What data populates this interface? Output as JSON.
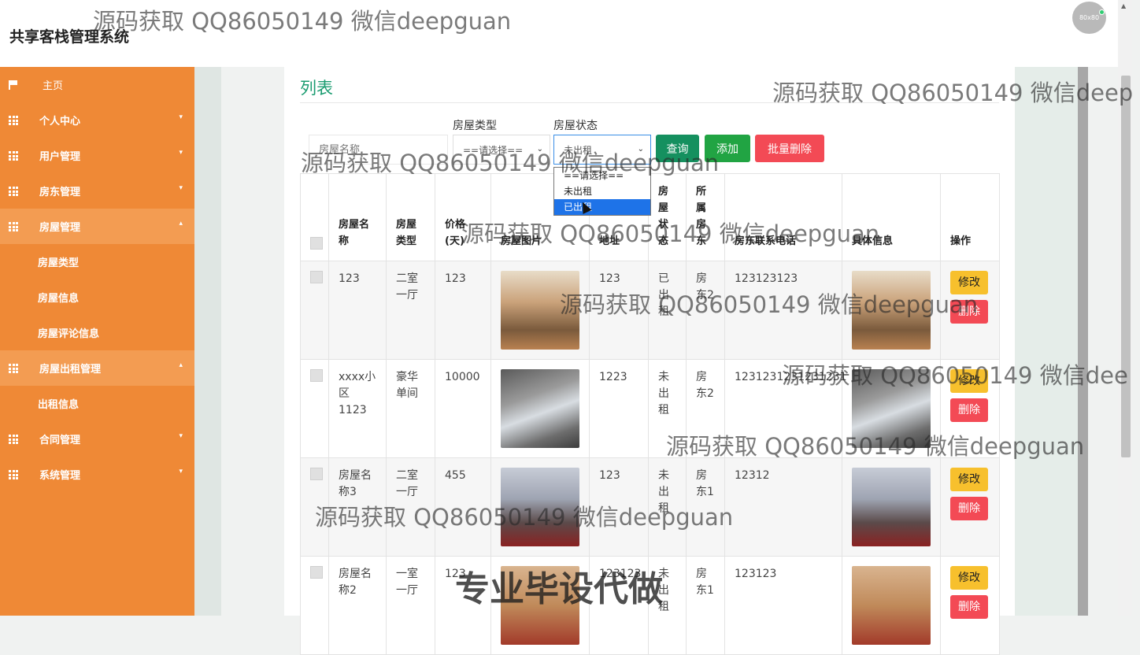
{
  "app": {
    "title": "共享客栈管理系统",
    "avatar_text": "80x80"
  },
  "sidebar": {
    "items": [
      {
        "label": "主页",
        "icon": "flag-icon",
        "caret": ""
      },
      {
        "label": "个人中心",
        "icon": "grid-icon",
        "caret": "▾"
      },
      {
        "label": "用户管理",
        "icon": "grid-icon",
        "caret": "▾"
      },
      {
        "label": "房东管理",
        "icon": "grid-icon",
        "caret": "▾"
      },
      {
        "label": "房屋管理",
        "icon": "grid-icon",
        "caret": "▴"
      },
      {
        "label": "房屋出租管理",
        "icon": "grid-icon",
        "caret": "▴"
      },
      {
        "label": "合同管理",
        "icon": "grid-icon",
        "caret": "▾"
      },
      {
        "label": "系统管理",
        "icon": "grid-icon",
        "caret": "▾"
      }
    ],
    "house_sub": [
      "房屋类型",
      "房屋信息",
      "房屋评论信息"
    ],
    "rent_sub": [
      "出租信息"
    ]
  },
  "main": {
    "title": "列表",
    "search": {
      "name_placeholder": "房屋名称",
      "type_label": "房屋类型",
      "type_value": "==请选择==",
      "status_label": "房屋状态",
      "status_value": "未出租"
    },
    "buttons": {
      "query": "查询",
      "add": "添加",
      "batch_delete": "批量删除"
    },
    "status_dropdown": {
      "options": [
        "==请选择==",
        "未出租",
        "已出租"
      ],
      "highlighted": "已出租"
    },
    "table": {
      "headers": [
        "房屋名称",
        "房屋类型",
        "价格(天)",
        "房屋图片",
        "地址",
        "房屋状态",
        "所属房东",
        "房东联系电话",
        "具体信息",
        "操作"
      ],
      "rows": [
        {
          "name": "123",
          "type": "二室一厅",
          "price": "123",
          "address": "123",
          "status": "已出租",
          "landlord": "房东2",
          "phone": "123123123"
        },
        {
          "name": "xxxx小区1123",
          "type": "豪华单间",
          "price": "10000",
          "address": "1223",
          "status": "未出租",
          "landlord": "房东2",
          "phone": "1231231231231231"
        },
        {
          "name": "房屋名称3",
          "type": "二室一厅",
          "price": "455",
          "address": "123",
          "status": "未出租",
          "landlord": "房东1",
          "phone": "12312"
        },
        {
          "name": "房屋名称2",
          "type": "一室一厅",
          "price": "123",
          "address": "123123",
          "status": "未出租",
          "landlord": "房东1",
          "phone": "123123"
        }
      ],
      "edit_label": "修改",
      "delete_label": "删除"
    }
  },
  "watermarks": {
    "text": "源码获取 QQ86050149 微信deepguan",
    "clipped_1": "源码获取 QQ86050149 微信deep",
    "clipped_2": "源码获取 QQ86050149 微信dee",
    "bottom": "专业毕设代做"
  },
  "colors": {
    "sidebar": "#ef8936",
    "accent_green": "#1a9c70",
    "query_btn": "#15905f",
    "add_btn": "#21a443",
    "delete_btn": "#f34a55",
    "edit_btn": "#f7c02d"
  }
}
